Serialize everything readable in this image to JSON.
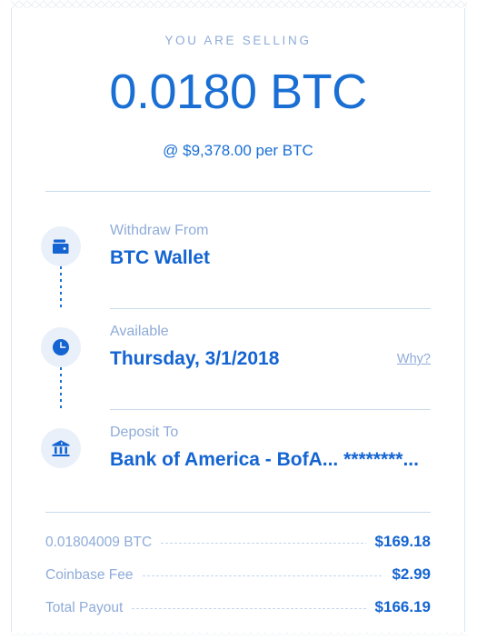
{
  "header": {
    "eyebrow": "YOU ARE SELLING",
    "amount": "0.0180 BTC",
    "rate": "@ $9,378.00 per BTC"
  },
  "timeline": [
    {
      "icon": "wallet-icon",
      "label": "Withdraw From",
      "value": "BTC Wallet"
    },
    {
      "icon": "clock-icon",
      "label": "Available",
      "value": "Thursday, 3/1/2018",
      "link": "Why?"
    },
    {
      "icon": "bank-icon",
      "label": "Deposit To",
      "value": "Bank of America - BofA... ********..."
    }
  ],
  "fees": [
    {
      "label": "0.01804009 BTC",
      "value": "$169.18"
    },
    {
      "label": "Coinbase Fee",
      "value": "$2.99"
    },
    {
      "label": "Total Payout",
      "value": "$166.19"
    }
  ],
  "colors": {
    "accent": "#1464d2",
    "muted": "#8eabd9",
    "rule": "#c8dbec",
    "bubble": "#e9f0fa"
  }
}
